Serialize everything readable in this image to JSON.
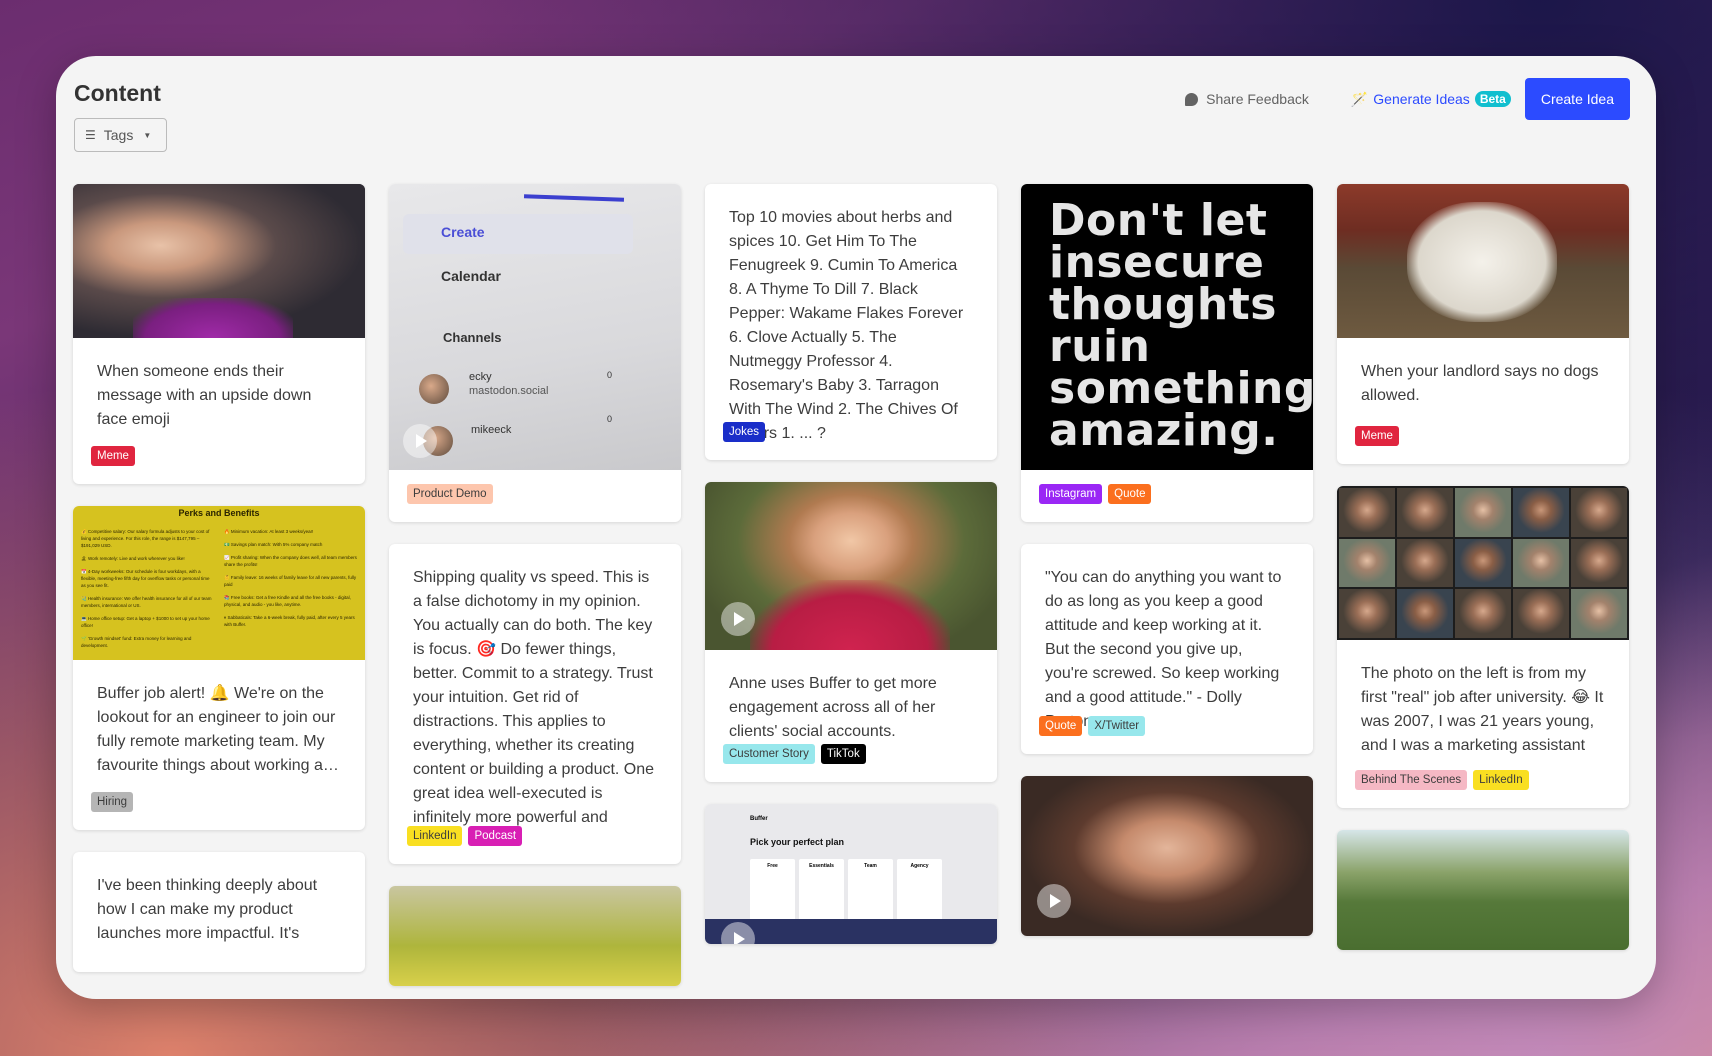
{
  "header": {
    "title": "Content",
    "share_feedback": "Share Feedback",
    "generate_ideas": "Generate Ideas",
    "beta_badge": "Beta",
    "create_idea": "Create Idea"
  },
  "filters": {
    "tags_label": "Tags"
  },
  "tag_colors": {
    "Meme": {
      "bg": "#e0253f",
      "fg": "#ffffff"
    },
    "Hiring": {
      "bg": "#b5b5b5",
      "fg": "#3d3d3d"
    },
    "Product Demo": {
      "bg": "#fdc6ad",
      "fg": "#3d3d3d"
    },
    "LinkedIn": {
      "bg": "#f9df21",
      "fg": "#3d3d3d"
    },
    "Podcast": {
      "bg": "#d81fb4",
      "fg": "#ffffff"
    },
    "Jokes": {
      "bg": "#1a2ec9",
      "fg": "#ffffff"
    },
    "Customer Story": {
      "bg": "#97e7ec",
      "fg": "#3d3d3d"
    },
    "TikTok": {
      "bg": "#000000",
      "fg": "#ffffff"
    },
    "Instagram": {
      "bg": "#9a27f5",
      "fg": "#ffffff"
    },
    "Quote": {
      "bg": "#fb6f1e",
      "fg": "#ffffff"
    },
    "X/Twitter": {
      "bg": "#97e7ec",
      "fg": "#3d3d3d"
    },
    "Behind The Scenes": {
      "bg": "#f5b8c4",
      "fg": "#3d3d3d"
    }
  },
  "cards": [
    {
      "id": "c1",
      "image": "toddler side-eye meme photo",
      "text": "When someone ends their message with an upside down face emoji",
      "tags": [
        "Meme"
      ]
    },
    {
      "id": "c2",
      "image": "Perks and Benefits graphic",
      "text": "Buffer job alert! 🔔 We're on the lookout for an engineer to join our fully remote marketing team. My favourite things about working a…",
      "tags": [
        "Hiring"
      ]
    },
    {
      "id": "c3",
      "image": "",
      "text": "I've been thinking deeply about how I can make my product launches more impactful. It's",
      "tags": []
    },
    {
      "id": "c4",
      "image": "Buffer app sidebar video",
      "video": true,
      "text": "",
      "tags": [
        "Product Demo"
      ]
    },
    {
      "id": "c5",
      "image": "",
      "text": "Shipping quality vs speed. This is a false dichotomy in my opinion. You actually can do both. The key is focus. 🎯 Do fewer things, better. Commit to a strategy. Trust your intuition. Get rid of distractions. This applies to everything, whether its creating content or building a product. One great idea well-executed is infinitely more powerful and than…",
      "tags": [
        "LinkedIn",
        "Podcast"
      ]
    },
    {
      "id": "c6",
      "image": "stadium crowd photo",
      "text": "",
      "tags": []
    },
    {
      "id": "c7",
      "image": "",
      "text": "Top 10 movies about herbs and spices 10. Get Him To The Fenugreek 9. Cumin To America 8. A Thyme To Dill 7. Black Pepper: Wakame Flakes Forever 6. Clove Actually 5. The Nutmeggy Professor 4. Rosemary's Baby 3. Tarragon With The Wind 2. The Chives Of Others 1. ... ?",
      "tags": [
        "Jokes"
      ]
    },
    {
      "id": "c8",
      "image": "Anne testimonial video",
      "video": true,
      "text": "Anne uses Buffer to get more engagement across all of her clients' social accounts.",
      "tags": [
        "Customer Story",
        "TikTok"
      ]
    },
    {
      "id": "c9",
      "image": "Buffer pricing page video",
      "video": true,
      "text": "",
      "tags": []
    },
    {
      "id": "c10",
      "image": "quote graphic",
      "image_text": "Don't let insecure thoughts ruin something amazing.",
      "text": "",
      "tags": [
        "Instagram",
        "Quote"
      ]
    },
    {
      "id": "c11",
      "image": "",
      "text": "\"You can do anything you want to do as long as you keep a good attitude and keep working at it. But the second you give up, you're screwed. So keep working and a good attitude.\" - Dolly Parton",
      "tags": [
        "Quote",
        "X/Twitter"
      ]
    },
    {
      "id": "c12",
      "image": "smiling woman video",
      "video": true,
      "text": "",
      "tags": []
    },
    {
      "id": "c13",
      "image": "plush lamb photo",
      "text": "When your landlord says no dogs allowed.",
      "tags": [
        "Meme"
      ]
    },
    {
      "id": "c14",
      "image": "video call team grid",
      "text": "The photo on the left is from my first \"real\" job after university. 😂 It was 2007, I was 21 years young, and I was a marketing assistant …",
      "tags": [
        "Behind The Scenes",
        "LinkedIn"
      ]
    },
    {
      "id": "c15",
      "image": "rugby field photo",
      "text": "",
      "tags": []
    }
  ],
  "media_text": {
    "perks_title": "Perks and Benefits",
    "perks_left": [
      "💰 Competitive salary: Our salary formula adjusts to your cost of living and experience. For this role, the range is $147,795 – $191,029 USD.",
      "🏝 Work remotely: Live and work wherever you like!",
      "📅 4-Day workweeks: Our schedule is four workdays, with a flexible, meeting-free fifth day for overflow tasks or personal time as you see fit.",
      "🩺 Health insurance: We offer health insurance for all of our team members, international or US.",
      "💻 Home office setup: Get a laptop + $1000 to set up your home office!",
      "🌱 'Growth mindset' fund: Extra money for learning and development."
    ],
    "perks_right": [
      "🔥 Minimum vacation: At least 3 weeks/year!",
      "💵 Savings plan match: With 5% company match",
      "📈 Profit sharing: When the company does well, all team members share the profits!",
      "👶 Family leave: 16 weeks of family leave for all new parents, fully paid",
      "📚 Free books: Get a free Kindle and all the free books - digital, physical, and audio - you like, anytime.",
      "⏸ Sabbaticals: Take a 6-week break, fully paid, after every 5 years with Buffer."
    ],
    "demo_create": "Create",
    "demo_calendar": "Calendar",
    "demo_channels": "Channels",
    "demo_channel1_name": "ecky",
    "demo_channel1_server": "mastodon.social",
    "demo_channel2_name": "mikeeck",
    "demo_count": "0",
    "pricing_title": "Pick your perfect plan",
    "pricing_plans": [
      "Free",
      "Essentials",
      "Team",
      "Agency"
    ],
    "pricing_brand": "Buffer"
  }
}
